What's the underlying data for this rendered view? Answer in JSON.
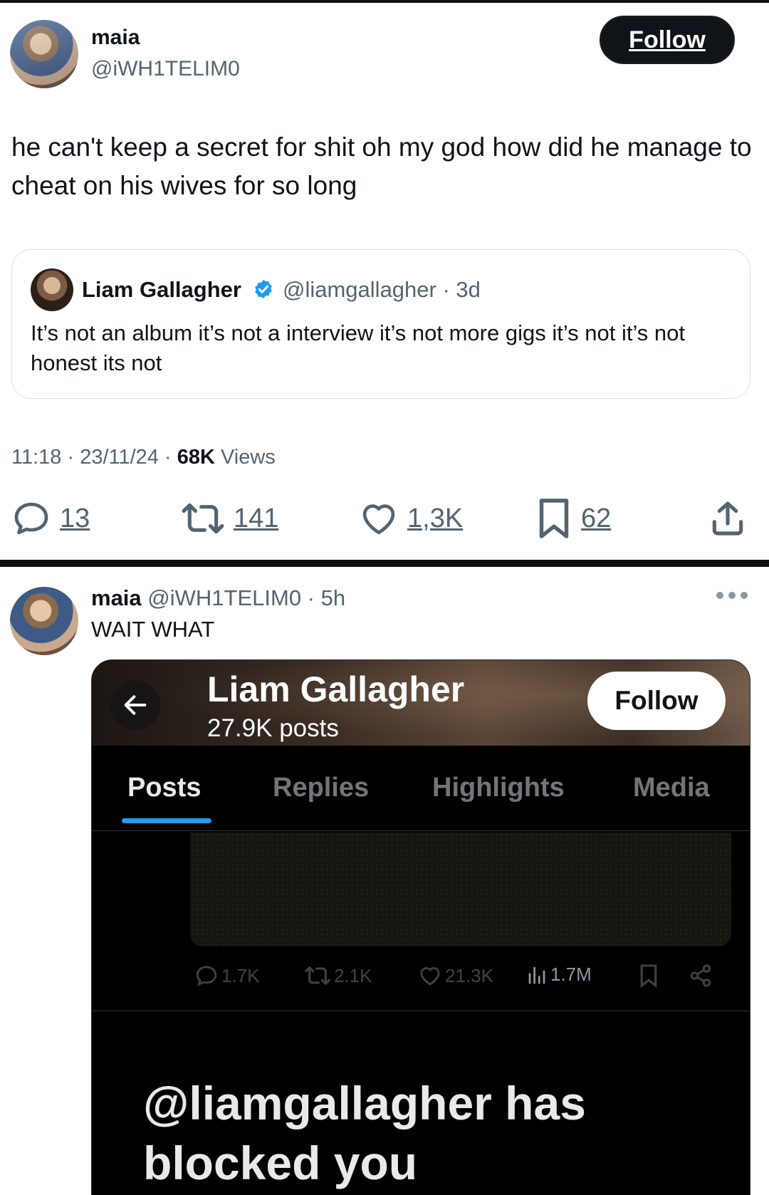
{
  "tweet": {
    "author_name": "maia",
    "author_handle": "@iWH1TELIM0",
    "follow_label": "Follow",
    "text": "he can't keep a secret for shit oh my god how did he manage to cheat on his wives for so long",
    "quoted": {
      "author_name": "Liam Gallagher",
      "verified": true,
      "meta": "@liamgallagher · 3d",
      "text": "It’s not an album it’s not a interview it’s not more gigs it’s not it’s not honest its not"
    },
    "time": "11:18 · 23/11/24 · ",
    "views_count": "68K",
    "views_label": " Views",
    "actions": {
      "replies": "13",
      "reposts": "141",
      "likes": "1,3K",
      "bookmarks": "62"
    }
  },
  "reply": {
    "author_name": "maia",
    "meta": "@iWH1TELIM0 · 5h",
    "text": "WAIT WHAT",
    "screenshot": {
      "profile_name": "Liam Gallagher",
      "profile_posts": "27.9K posts",
      "follow_label": "Follow",
      "tabs": [
        "Posts",
        "Replies",
        "Highlights",
        "Media"
      ],
      "active_tab": "Posts",
      "post_actions": {
        "replies": "1.7K",
        "reposts": "2.1K",
        "likes": "21.3K",
        "views": "1.7M"
      },
      "blocked_message": "@liamgallagher has blocked you"
    }
  },
  "colors": {
    "accent": "#1d9bf0",
    "text": "#0f1419",
    "secondary": "#536471",
    "verified": "#1d9bf0"
  },
  "icons": [
    "reply-icon",
    "repost-icon",
    "like-icon",
    "bookmark-icon",
    "share-icon",
    "verified-badge-icon",
    "back-arrow-icon",
    "more-icon",
    "views-icon"
  ]
}
